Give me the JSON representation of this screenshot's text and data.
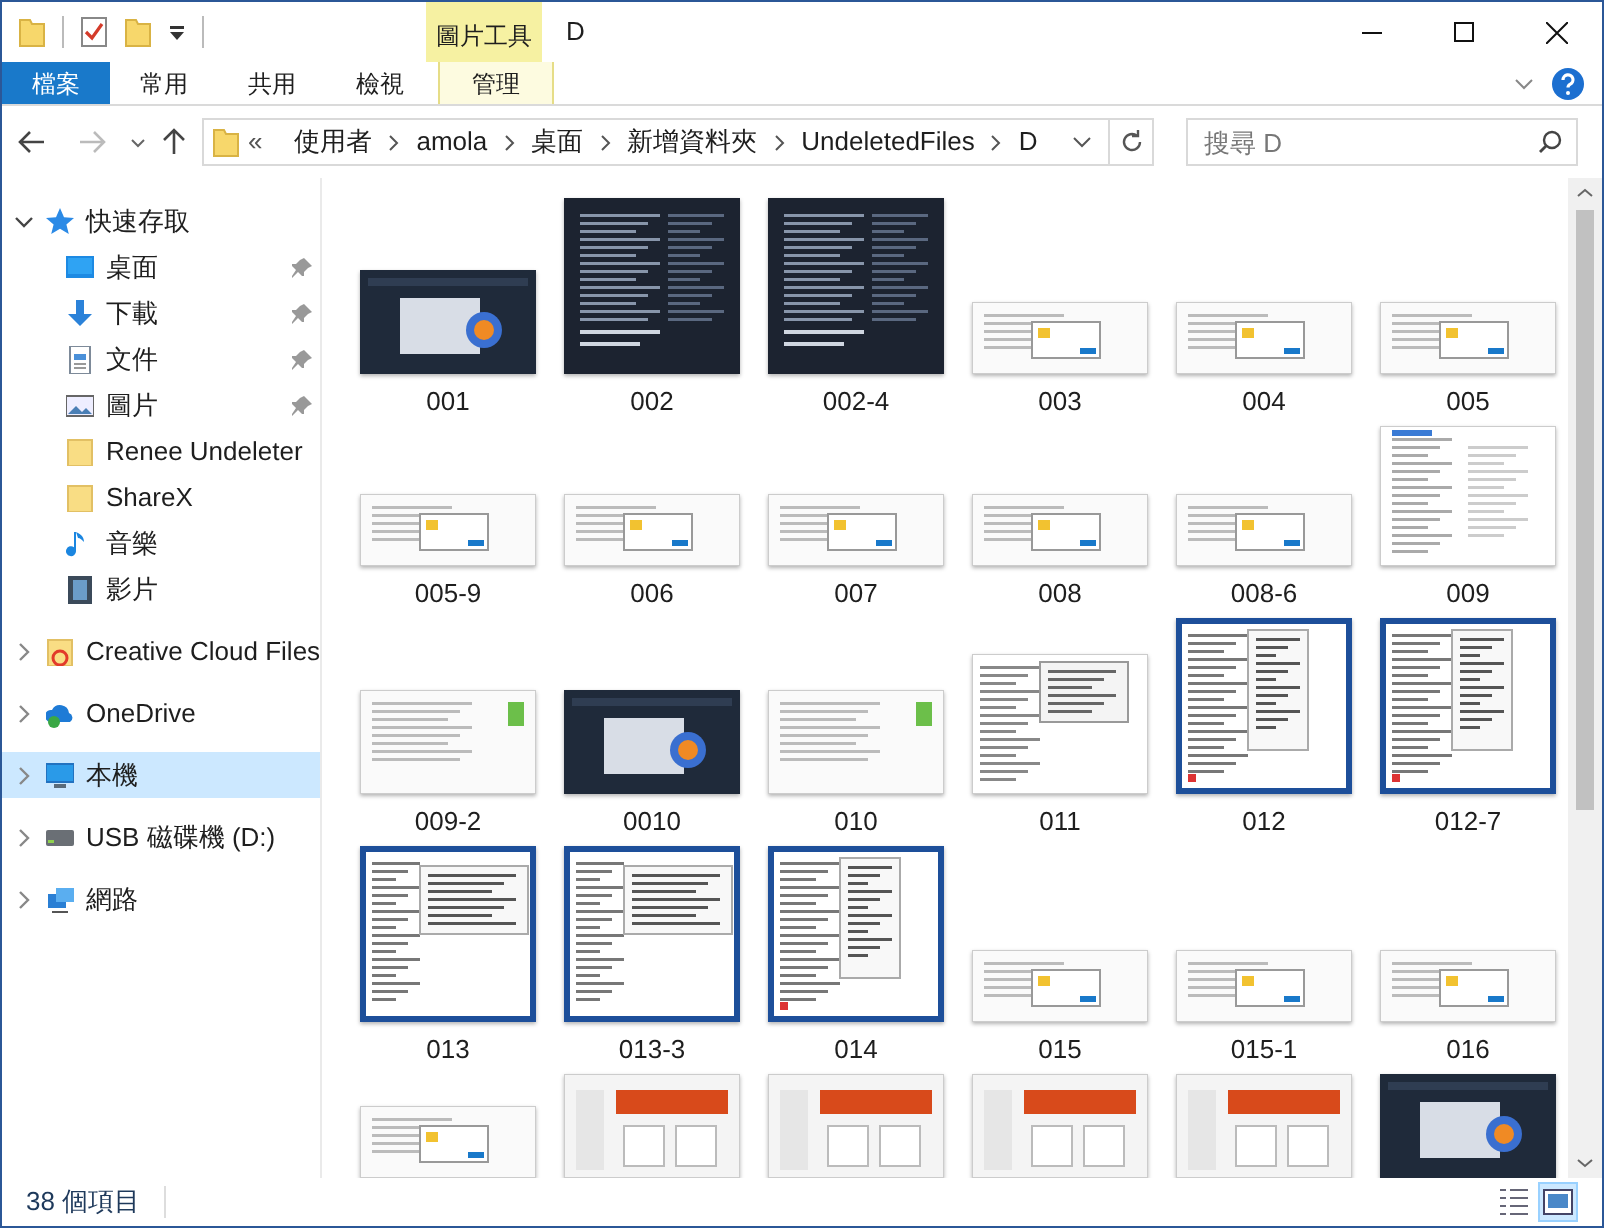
{
  "title_bar": {
    "title": "D"
  },
  "ribbon": {
    "context_group": "圖片工具",
    "tabs": [
      {
        "label": "檔案",
        "kind": "file",
        "selected": false
      },
      {
        "label": "常用",
        "kind": "normal",
        "selected": false
      },
      {
        "label": "共用",
        "kind": "normal",
        "selected": false
      },
      {
        "label": "檢視",
        "kind": "normal",
        "selected": false
      },
      {
        "label": "管理",
        "kind": "context",
        "selected": false
      }
    ]
  },
  "address_bar": {
    "overflow": "«",
    "segments": [
      "使用者",
      "amola",
      "桌面",
      "新增資料夾",
      "UndeletedFiles",
      "D"
    ]
  },
  "search": {
    "placeholder": "搜尋 D"
  },
  "sidebar": {
    "items": [
      {
        "label": "快速存取",
        "kind": "star",
        "expanded": true,
        "selected": false,
        "children": [
          {
            "label": "桌面",
            "kind": "desktop",
            "pinned": true
          },
          {
            "label": "下載",
            "kind": "download",
            "pinned": true
          },
          {
            "label": "文件",
            "kind": "document",
            "pinned": true
          },
          {
            "label": "圖片",
            "kind": "pictures",
            "pinned": true
          },
          {
            "label": "Renee Undeleter",
            "kind": "folder",
            "pinned": false
          },
          {
            "label": "ShareX",
            "kind": "folder",
            "pinned": false
          },
          {
            "label": "音樂",
            "kind": "music",
            "pinned": false
          },
          {
            "label": "影片",
            "kind": "video",
            "pinned": false
          }
        ]
      },
      {
        "label": "Creative Cloud Files",
        "kind": "cc-folder",
        "expanded": false,
        "selected": false
      },
      {
        "label": "OneDrive",
        "kind": "cloud",
        "expanded": false,
        "selected": false
      },
      {
        "label": "本機",
        "kind": "computer",
        "expanded": false,
        "selected": true
      },
      {
        "label": "USB 磁碟機 (D:)",
        "kind": "drive",
        "expanded": false,
        "selected": false
      },
      {
        "label": "網路",
        "kind": "network",
        "expanded": false,
        "selected": false
      }
    ]
  },
  "files": [
    {
      "name": "001",
      "kind": "dark-wide"
    },
    {
      "name": "002",
      "kind": "dark-tall"
    },
    {
      "name": "002-4",
      "kind": "dark-tall"
    },
    {
      "name": "003",
      "kind": "light-wide"
    },
    {
      "name": "004",
      "kind": "light-wide"
    },
    {
      "name": "005",
      "kind": "light-wide"
    },
    {
      "name": "005-9",
      "kind": "light-wide"
    },
    {
      "name": "006",
      "kind": "light-wide"
    },
    {
      "name": "007",
      "kind": "light-wide"
    },
    {
      "name": "008",
      "kind": "light-wide"
    },
    {
      "name": "008-6",
      "kind": "light-wide"
    },
    {
      "name": "009",
      "kind": "light-tall"
    },
    {
      "name": "009-2",
      "kind": "light-mid"
    },
    {
      "name": "0010",
      "kind": "dark-wide"
    },
    {
      "name": "010",
      "kind": "light-mid"
    },
    {
      "name": "011",
      "kind": "menu"
    },
    {
      "name": "012",
      "kind": "blue-tall"
    },
    {
      "name": "012-7",
      "kind": "blue-tall"
    },
    {
      "name": "013",
      "kind": "blue-wide"
    },
    {
      "name": "013-3",
      "kind": "blue-wide"
    },
    {
      "name": "014",
      "kind": "blue-tall"
    },
    {
      "name": "015",
      "kind": "light-wide"
    },
    {
      "name": "015-1",
      "kind": "light-wide"
    },
    {
      "name": "016",
      "kind": "light-wide"
    },
    {
      "kind": "light-wide"
    },
    {
      "kind": "orange"
    },
    {
      "kind": "orange"
    },
    {
      "kind": "orange"
    },
    {
      "kind": "orange"
    },
    {
      "kind": "dark-wide"
    }
  ],
  "status_bar": {
    "item_count": "38 個項目",
    "views": [
      {
        "kind": "details",
        "selected": false
      },
      {
        "kind": "large-icons",
        "selected": true
      }
    ]
  }
}
